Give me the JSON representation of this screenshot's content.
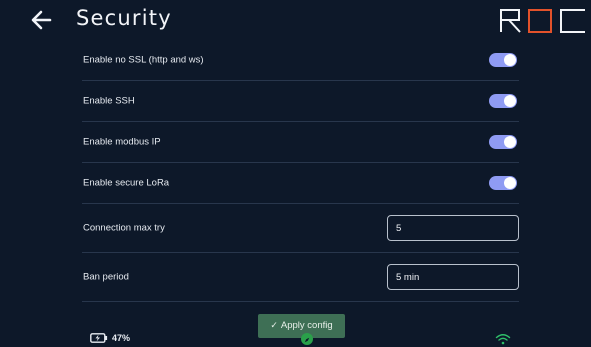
{
  "header": {
    "title": "Security",
    "back_icon": "arrow-left-icon",
    "logo_text": "ROC"
  },
  "settings": {
    "toggles": [
      {
        "label": "Enable no SSL (http and ws)",
        "enabled": true
      },
      {
        "label": "Enable SSH",
        "enabled": true
      },
      {
        "label": "Enable modbus IP",
        "enabled": true
      },
      {
        "label": "Enable secure LoRa",
        "enabled": true
      }
    ],
    "inputs": [
      {
        "label": "Connection max try",
        "value": "5"
      },
      {
        "label": "Ban period",
        "value": "5 min"
      }
    ]
  },
  "apply": {
    "label": "Apply config",
    "icon": "check-icon"
  },
  "status": {
    "battery_percent": "47%",
    "battery_icon": "battery-charging-icon",
    "center_icon": "compass-icon",
    "wifi_icon": "wifi-icon"
  },
  "colors": {
    "background": "#0d1829",
    "toggle_on": "#8f9bf3",
    "apply_button": "#3e6f55",
    "wifi": "#2fbf6a",
    "logo_accent": "#e2522b",
    "divider": "#28364c"
  }
}
